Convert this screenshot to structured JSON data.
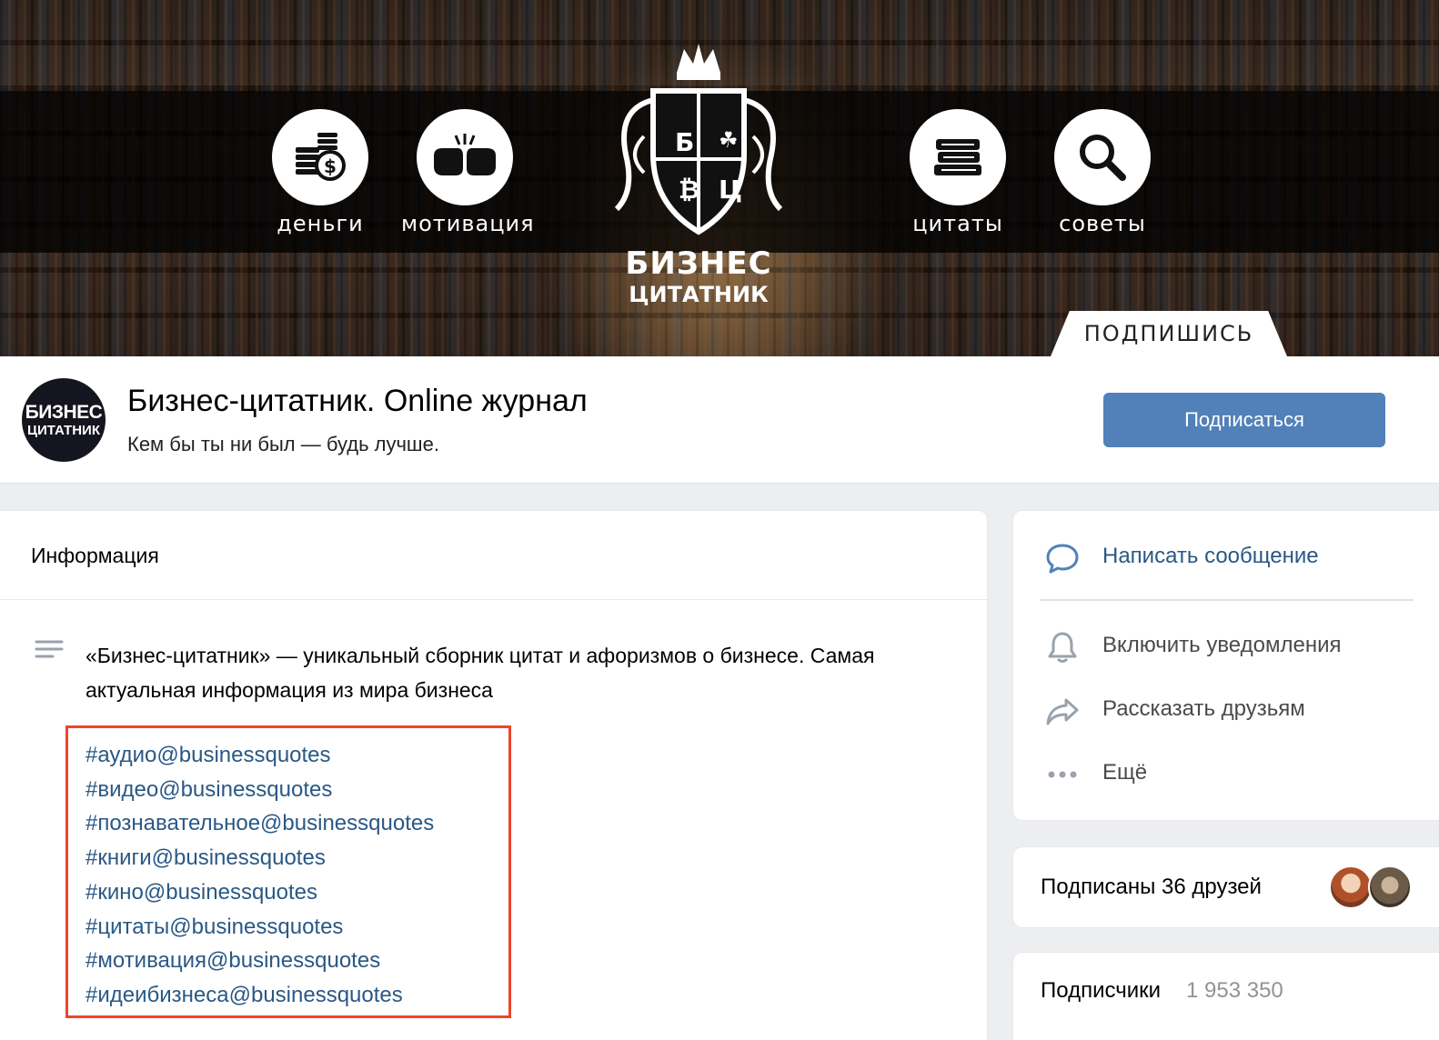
{
  "cover": {
    "nav": [
      {
        "label": "деньги",
        "icon": "money-icon"
      },
      {
        "label": "мотивация",
        "icon": "fists-icon"
      },
      {
        "label": "цитаты",
        "icon": "books-icon"
      },
      {
        "label": "советы",
        "icon": "magnifier-icon"
      }
    ],
    "crest_letters": [
      "Б",
      "☘",
      "₿",
      "Ц"
    ],
    "crest_title": "БИЗНЕС",
    "crest_subtitle": "ЦИТАТНИК",
    "subscribe_tab": "ПОДПИШИСЬ"
  },
  "header": {
    "avatar_line1": "БИЗНЕС",
    "avatar_line2": "ЦИТАТНИК",
    "name": "Бизнес-цитатник. Online журнал",
    "status": "Кем бы ты ни был — будь лучше.",
    "subscribe_button": "Подписаться"
  },
  "info": {
    "title": "Информация",
    "description": "«Бизнес-цитатник» — уникальный сборник цитат и афоризмов о бизнесе. Самая актуальная информация из мира бизнеса",
    "tags": [
      "#аудио@businessquotes",
      "#видео@businessquotes",
      "#познавательное@businessquotes",
      "#книги@businessquotes",
      "#кино@businessquotes",
      "#цитаты@businessquotes",
      "#мотивация@businessquotes",
      "#идеибизнеса@businessquotes"
    ],
    "highlight_color": "#f0452a"
  },
  "actions": {
    "message": "Написать сообщение",
    "notifications": "Включить уведомления",
    "share": "Рассказать друзьям",
    "more": "Ещё"
  },
  "friends": {
    "text": "Подписаны 36 друзей"
  },
  "subscribers": {
    "label": "Подписчики",
    "count": "1 953 350"
  },
  "colors": {
    "accent": "#5181b8",
    "link": "#2a5885",
    "background": "#edeef0"
  }
}
